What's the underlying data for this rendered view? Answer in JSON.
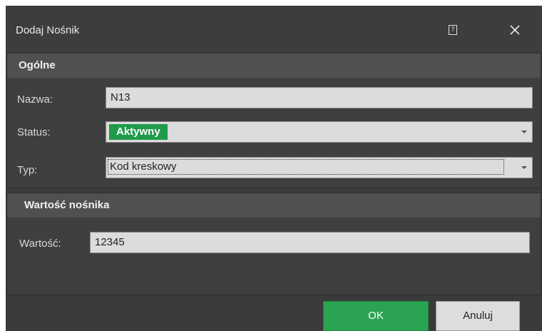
{
  "window": {
    "title": "Dodaj Nośnik",
    "help_icon": "help-icon",
    "close_icon": "close-icon"
  },
  "general": {
    "header": "Ogólne",
    "name_label": "Nazwa:",
    "name_value": "N13",
    "status_label": "Status:",
    "status_value": "Aktywny",
    "status_color": "#1f9a4a",
    "type_label": "Typ:",
    "type_value": "Kod kreskowy"
  },
  "carrier_value": {
    "header": "Wartość nośnika",
    "value_label": "Wartość:",
    "value": "12345"
  },
  "buttons": {
    "ok_label": "OK",
    "ok_color": "#2aa352",
    "cancel_label": "Anuluj"
  }
}
